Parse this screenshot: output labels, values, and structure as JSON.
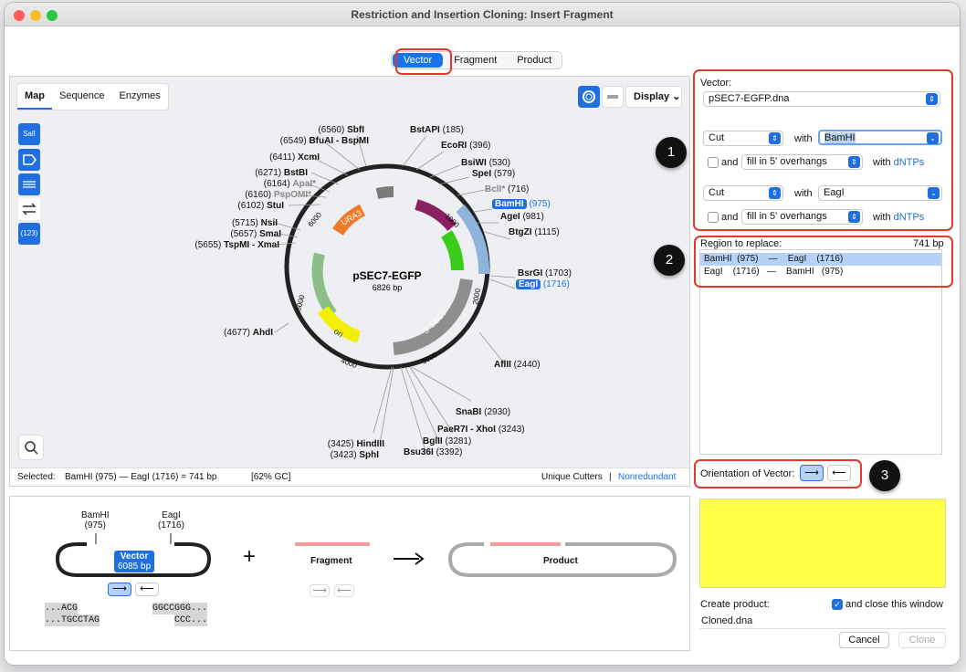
{
  "window": {
    "title": "Restriction and Insertion Cloning: Insert Fragment"
  },
  "tabs": [
    "Vector",
    "Fragment",
    "Product"
  ],
  "map": {
    "tabs": [
      "Map",
      "Sequence",
      "Enzymes"
    ],
    "display_label": "Display",
    "plasmid_name": "pSEC7-EGFP",
    "plasmid_size": "6826 bp",
    "tool_labels": [
      "SalI",
      "(123)"
    ],
    "enzymes_left": [
      {
        "pos": "(6560)",
        "name": "SbfI"
      },
      {
        "pos": "(6549)",
        "name": "BfuAI - BspMI"
      },
      {
        "pos": "(6411)",
        "name": "XcmI"
      },
      {
        "pos": "(6271)",
        "name": "BstBI"
      },
      {
        "pos": "(6164)",
        "name": "ApaI*"
      },
      {
        "pos": "(6160)",
        "name": "PspOMI*"
      },
      {
        "pos": "(6102)",
        "name": "StuI"
      },
      {
        "pos": "(5715)",
        "name": "NsiI"
      },
      {
        "pos": "(5657)",
        "name": "SmaI"
      },
      {
        "pos": "(5655)",
        "name": "TspMI - XmaI"
      },
      {
        "pos": "(4677)",
        "name": "AhdI"
      },
      {
        "pos": "(3425)",
        "name": "HindIII"
      },
      {
        "pos": "(3423)",
        "name": "SphI"
      }
    ],
    "enzymes_right": [
      {
        "name": "BstAPI",
        "pos": "(185)"
      },
      {
        "name": "EcoRI",
        "pos": "(396)"
      },
      {
        "name": "BsiWI",
        "pos": "(530)"
      },
      {
        "name": "SpeI",
        "pos": "(579)"
      },
      {
        "name": "BclI*",
        "pos": "(716)"
      },
      {
        "name": "BamHI",
        "pos": "(975)"
      },
      {
        "name": "AgeI",
        "pos": "(981)"
      },
      {
        "name": "BtgZI",
        "pos": "(1115)"
      },
      {
        "name": "BsrGI",
        "pos": "(1703)"
      },
      {
        "name": "EagI",
        "pos": "(1716)"
      },
      {
        "name": "AflII",
        "pos": "(2440)"
      },
      {
        "name": "SnaBI",
        "pos": "(2930)"
      },
      {
        "name": "PaeR7I - XhoI",
        "pos": "(3243)"
      },
      {
        "name": "BglII",
        "pos": "(3281)"
      },
      {
        "name": "Bsu36I",
        "pos": "(3392)"
      }
    ],
    "features": [
      "URA3",
      "ori",
      "3' SEC7"
    ],
    "ticks": [
      "1000",
      "2000",
      "3000",
      "4000",
      "5000",
      "6000"
    ],
    "status": {
      "selected": "Selected:",
      "range": "BamHI (975)  —  EagI (1716)  =  741 bp",
      "gc": "[62% GC]",
      "unique": "Unique Cutters",
      "sep": "|",
      "nonred": "Nonredundant"
    }
  },
  "vector": {
    "label": "Vector:",
    "file": "pSEC7-EGFP.dna",
    "cut1": {
      "action": "Cut",
      "with": "with",
      "enzyme": "BamHI",
      "and": "and",
      "fill": "fill in 5' overhangs",
      "with_dntps": "with",
      "dntps": "dNTPs"
    },
    "cut2": {
      "action": "Cut",
      "with": "with",
      "enzyme": "EagI",
      "and": "and",
      "fill": "fill in 5' overhangs",
      "with_dntps": "with",
      "dntps": "dNTPs"
    }
  },
  "region": {
    "label": "Region to replace:",
    "size": "741 bp",
    "rows": [
      "BamHI  (975)    —    EagI    (1716)",
      "EagI    (1716)   —    BamHI   (975)"
    ]
  },
  "orientation": {
    "label": "Orientation of Vector:"
  },
  "badges": [
    "1",
    "2",
    "3"
  ],
  "diagram": {
    "left_site": {
      "name": "BamHI",
      "pos": "(975)"
    },
    "right_site": {
      "name": "EagI",
      "pos": "(1716)"
    },
    "vector_label": "Vector",
    "vector_size": "6085 bp",
    "plus": "+",
    "fragment_label": "Fragment",
    "product_label": "Product",
    "seq_left_top": "...ACG",
    "seq_left_bottom": "...TGCCTAG",
    "seq_right_top": "GGCCGGG...",
    "seq_right_bottom": "CCC..."
  },
  "create": {
    "label": "Create product:",
    "close_label": "and close this window",
    "filename": "Cloned.dna",
    "cancel": "Cancel",
    "clone": "Clone"
  },
  "colors": {
    "accent": "#1f6fe0",
    "highlight_red": "#e23a2a",
    "yellow": "#ffff47"
  }
}
